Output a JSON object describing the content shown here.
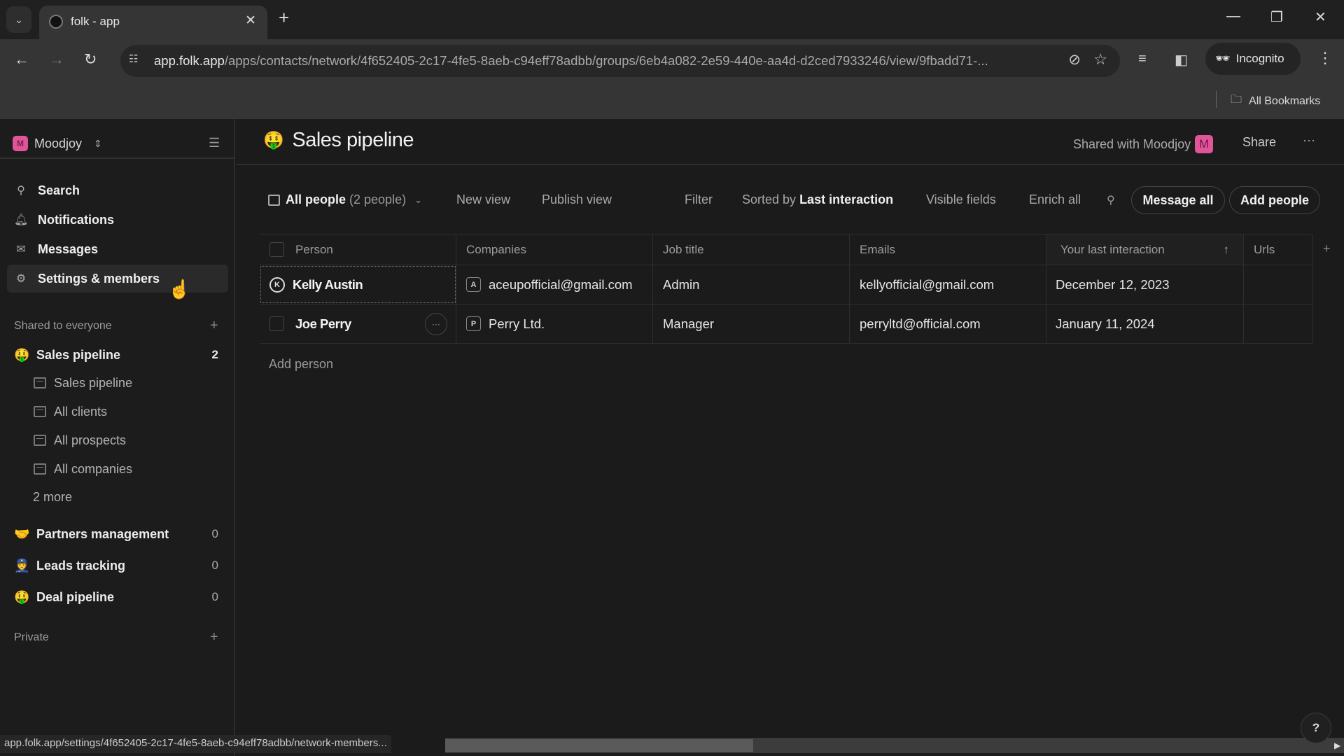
{
  "browser": {
    "tab_title": "folk - app",
    "url_host": "app.folk.app",
    "url_path": "/apps/contacts/network/4f652405-2c17-4fe5-8aeb-c94eff78adbb/groups/6eb4a082-2e59-440e-aa4d-d2ced7933246/view/9fbadd71-...",
    "incognito_label": "Incognito",
    "bookmarks_label": "All Bookmarks",
    "status_url": "app.folk.app/settings/4f652405-2c17-4fe5-8aeb-c94eff78adbb/network-members..."
  },
  "sidebar": {
    "workspace": {
      "initial": "M",
      "name": "Moodjoy"
    },
    "nav": [
      {
        "label": "Search",
        "icon": "search-icon"
      },
      {
        "label": "Notifications",
        "icon": "bell-icon"
      },
      {
        "label": "Messages",
        "icon": "mail-icon"
      },
      {
        "label": "Settings & members",
        "icon": "gear-icon"
      }
    ],
    "shared_title": "Shared to everyone",
    "groups": [
      {
        "emoji": "🤑",
        "label": "Sales pipeline",
        "count": "2"
      },
      {
        "emoji": "🤝",
        "label": "Partners management",
        "count": "0"
      },
      {
        "emoji": "👮",
        "label": "Leads tracking",
        "count": "0"
      },
      {
        "emoji": "🤑",
        "label": "Deal pipeline",
        "count": "0"
      }
    ],
    "views": [
      {
        "label": "Sales pipeline",
        "icon": "kanban-icon"
      },
      {
        "label": "All clients",
        "icon": "table-icon"
      },
      {
        "label": "All prospects",
        "icon": "table-icon"
      },
      {
        "label": "All companies",
        "icon": "table-icon"
      }
    ],
    "more_label": "2 more",
    "private_title": "Private"
  },
  "header": {
    "emoji": "🤑",
    "title": "Sales pipeline",
    "shared_with": "Shared with Moodjoy",
    "shared_avatar": "M",
    "share_label": "Share",
    "more_label": "···"
  },
  "toolbar": {
    "view_name": "All people",
    "view_count": "(2 people)",
    "new_view": "New view",
    "publish_view": "Publish view",
    "filter": "Filter",
    "sorted_prefix": "Sorted by",
    "sorted_value": "Last interaction",
    "visible_fields": "Visible fields",
    "enrich_all": "Enrich all",
    "message_all": "Message all",
    "add_people": "Add people"
  },
  "table": {
    "columns": [
      "Person",
      "Companies",
      "Job title",
      "Emails",
      "Your last interaction",
      "Urls"
    ],
    "rows": [
      {
        "initial": "K",
        "person": "Kelly Austin",
        "company_initial": "A",
        "company": "aceupofficial@gmail.com",
        "job_title": "Admin",
        "email": "kellyofficial@gmail.com",
        "last_interaction": "December 12, 2023",
        "urls": ""
      },
      {
        "initial": "",
        "person": "Joe Perry",
        "company_initial": "P",
        "company": "Perry Ltd.",
        "job_title": "Manager",
        "email": "perryltd@official.com",
        "last_interaction": "January 11, 2024",
        "urls": ""
      }
    ],
    "add_person": "Add person"
  },
  "help_label": "?"
}
